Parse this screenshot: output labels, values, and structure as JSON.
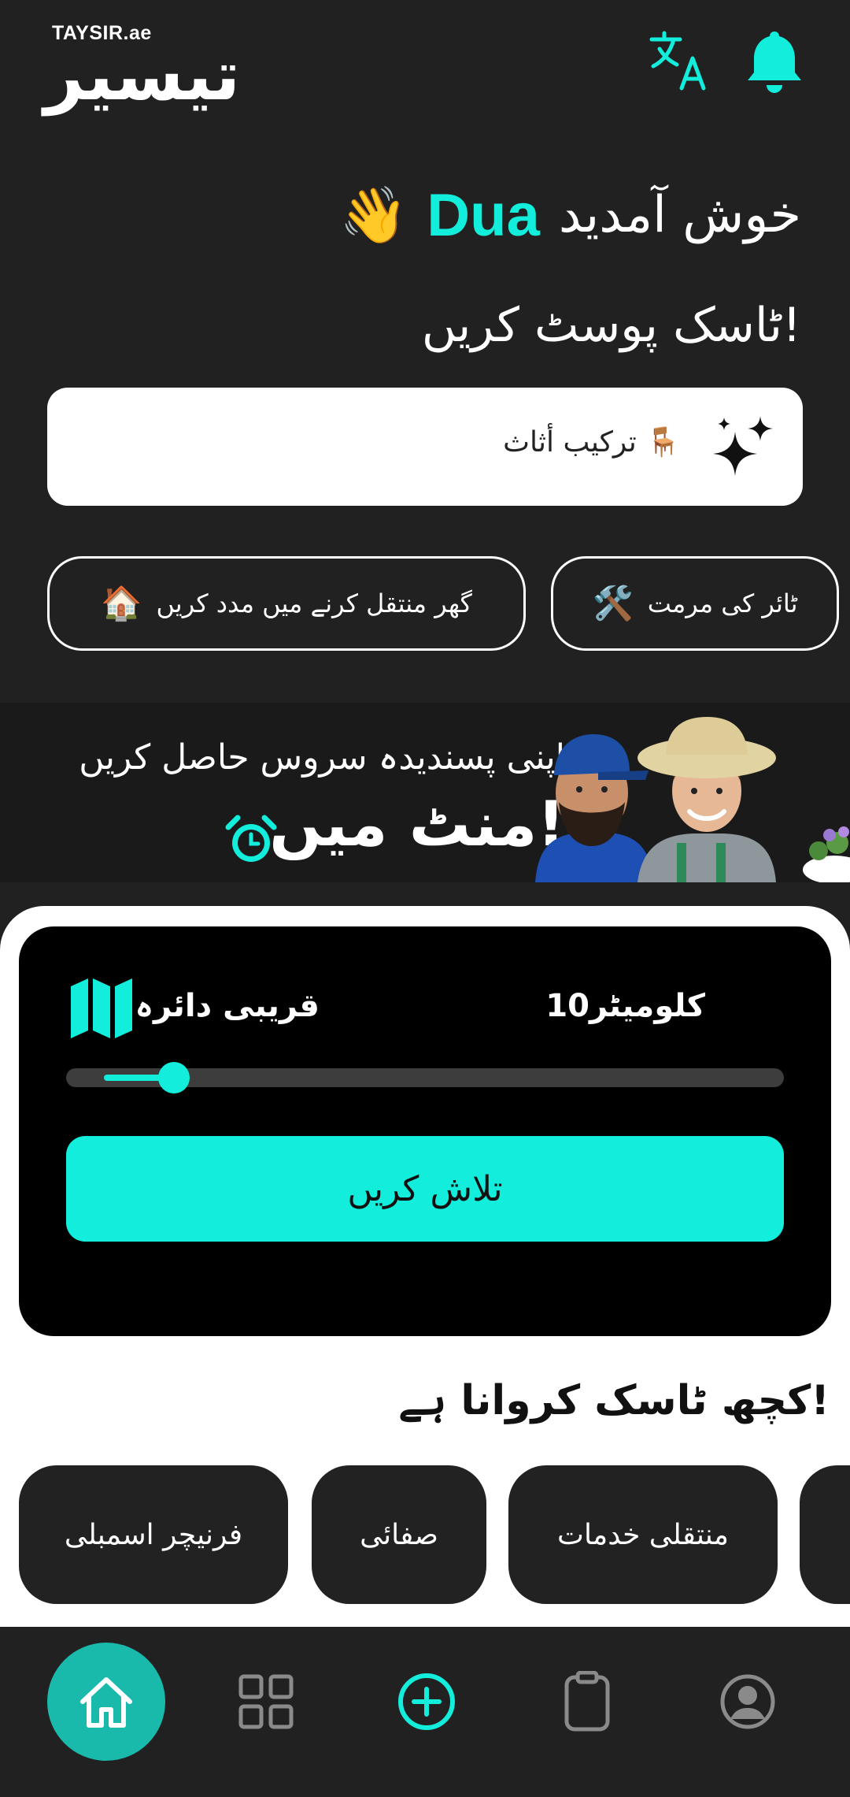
{
  "header": {
    "logo_small": "TAYSIR.ae",
    "logo_big": "تیسیر",
    "translate_icon": "translate-icon",
    "bell_icon": "bell-icon"
  },
  "welcome": {
    "text": "خوش آمدید",
    "name": "Dua",
    "emoji": "👋"
  },
  "post_task": {
    "title": "ٹاسک پوسٹ کریں!",
    "input_value": "تركيب أثاث 🪑",
    "sparkle_icon": "sparkle-icon"
  },
  "suggestions": [
    {
      "label": "ٹائر کی مرمت",
      "emoji": "🛠️"
    },
    {
      "label": "گھر منتقل کرنے میں مدد کریں",
      "emoji": "🏠"
    }
  ],
  "banner": {
    "line1": "اپنی پسندیدہ سروس حاصل کریں",
    "line2": "منٹ میں!",
    "alarm_icon": "alarm-clock-icon"
  },
  "radius": {
    "label": "قریبی دائرہ",
    "value": "10کلومیٹر",
    "level": 0.15,
    "search_label": "تلاش کریں"
  },
  "categories": {
    "title": "کچھ ٹاسک کروانا ہے!",
    "items": [
      "منتقلی خدمات",
      "صفائی",
      "فرنیچر اسمبلی"
    ]
  },
  "nav": {
    "items": [
      "home-icon",
      "grid-icon",
      "add-circle-icon",
      "clipboard-icon",
      "profile-icon"
    ]
  },
  "colors": {
    "accent": "#12eedb",
    "home_active": "#19b9ac",
    "background": "#212121"
  }
}
